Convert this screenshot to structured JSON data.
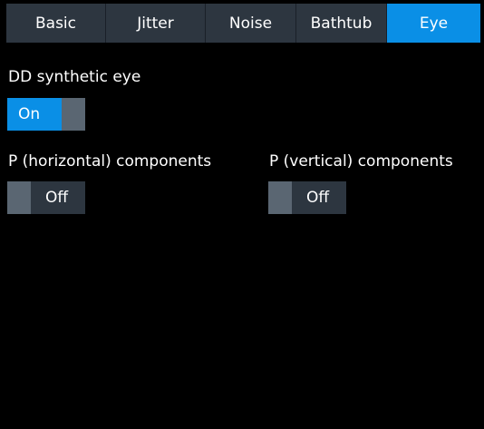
{
  "tabs": [
    {
      "label": "Basic",
      "active": false
    },
    {
      "label": "Jitter",
      "active": false
    },
    {
      "label": "Noise",
      "active": false
    },
    {
      "label": "Bathtub",
      "active": false
    },
    {
      "label": "Eye",
      "active": true
    }
  ],
  "dd_synthetic_eye": {
    "label": "DD synthetic eye",
    "state": "On"
  },
  "p_horizontal": {
    "label": "P (horizontal) components",
    "state": "Off"
  },
  "p_vertical": {
    "label": "P (vertical) components",
    "state": "Off"
  },
  "colors": {
    "background": "#000000",
    "tab_inactive": "#2d3640",
    "tab_active": "#0a8fe6",
    "toggle_on": "#0a8fe6",
    "toggle_knob": "#5a6672",
    "toggle_off": "#2d3640"
  }
}
